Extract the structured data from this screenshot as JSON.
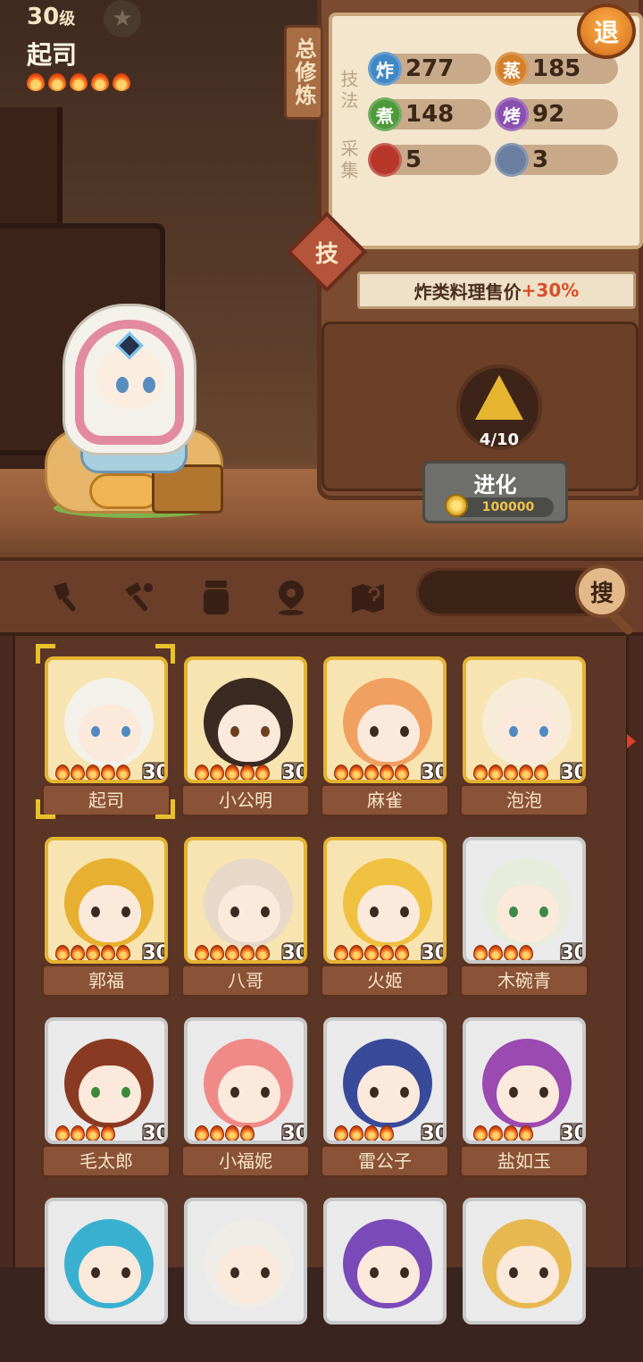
{
  "player": {
    "level": "30",
    "level_suffix": "级",
    "name": "起司",
    "flames": 5
  },
  "board": {
    "tag": "总修炼",
    "label_skill": "技法",
    "label_gather": "采集",
    "stats": [
      {
        "icon": "炸",
        "value": "277",
        "color": "#3f88c5"
      },
      {
        "icon": "蒸",
        "value": "185",
        "color": "#d4802a"
      },
      {
        "icon": "煮",
        "value": "148",
        "color": "#4e9a3a"
      },
      {
        "icon": "烤",
        "value": "92",
        "color": "#8a4fb0"
      },
      {
        "icon": "",
        "value": "5",
        "color": "#b8362a",
        "icon_name": "meat-icon"
      },
      {
        "icon": "",
        "value": "3",
        "color": "#6a7fa0",
        "icon_name": "fish-icon"
      }
    ]
  },
  "retreat_button": "退",
  "skill_button": "技",
  "bonus": {
    "prefix": "炸类料理售价",
    "value": "+30%"
  },
  "evolution": {
    "progress": "4/10",
    "button_label": "进化",
    "cost": "100000"
  },
  "toolbar": {
    "search_label": "搜",
    "tools": [
      "shovel-icon",
      "hoe-icon",
      "jar-icon",
      "location-icon",
      "map-icon"
    ]
  },
  "characters": [
    {
      "name": "起司",
      "level": "30",
      "flames": 5,
      "rarity": "gold",
      "hair": "#f4f1ea",
      "eye": "#4d8ac0",
      "selected": true
    },
    {
      "name": "小公明",
      "level": "30",
      "flames": 5,
      "rarity": "gold",
      "hair": "#3a2a22",
      "eye": "#6a4020"
    },
    {
      "name": "麻雀",
      "level": "30",
      "flames": 5,
      "rarity": "gold",
      "hair": "#f0a060",
      "eye": "#3a2a22"
    },
    {
      "name": "泡泡",
      "level": "30",
      "flames": 5,
      "rarity": "gold",
      "hair": "#f6ecd8",
      "eye": "#4d8ac0"
    },
    {
      "name": "郭福",
      "level": "30",
      "flames": 5,
      "rarity": "gold",
      "hair": "#e8b030",
      "eye": "#3a2a22"
    },
    {
      "name": "八哥",
      "level": "30",
      "flames": 5,
      "rarity": "gold",
      "hair": "#e8d8c8",
      "eye": "#3a2a22"
    },
    {
      "name": "火姬",
      "level": "30",
      "flames": 5,
      "rarity": "gold",
      "hair": "#f0c040",
      "eye": "#3a2a22"
    },
    {
      "name": "木碗青",
      "level": "30",
      "flames": 4,
      "rarity": "silver",
      "hair": "#e8ecdc",
      "eye": "#3a8a4a"
    },
    {
      "name": "毛太郎",
      "level": "30",
      "flames": 4,
      "rarity": "silver",
      "hair": "#8a3a22",
      "eye": "#3a8a3a"
    },
    {
      "name": "小福妮",
      "level": "30",
      "flames": 4,
      "rarity": "silver",
      "hair": "#f08a88",
      "eye": "#3a2a22"
    },
    {
      "name": "雷公子",
      "level": "30",
      "flames": 4,
      "rarity": "silver",
      "hair": "#3a4a9a",
      "eye": "#3a2a22"
    },
    {
      "name": "盐如玉",
      "level": "30",
      "flames": 4,
      "rarity": "silver",
      "hair": "#9a4ab0",
      "eye": "#3a2a22"
    },
    {
      "name": "",
      "level": "",
      "flames": 0,
      "rarity": "silver",
      "hair": "#3ab0d0",
      "eye": "#3a2a22"
    },
    {
      "name": "",
      "level": "",
      "flames": 0,
      "rarity": "silver",
      "hair": "#f0ece8",
      "eye": "#3a2a22"
    },
    {
      "name": "",
      "level": "",
      "flames": 0,
      "rarity": "silver",
      "hair": "#7a4ab8",
      "eye": "#3a2a22"
    },
    {
      "name": "",
      "level": "",
      "flames": 0,
      "rarity": "silver",
      "hair": "#e8b850",
      "eye": "#3a2a22"
    }
  ]
}
